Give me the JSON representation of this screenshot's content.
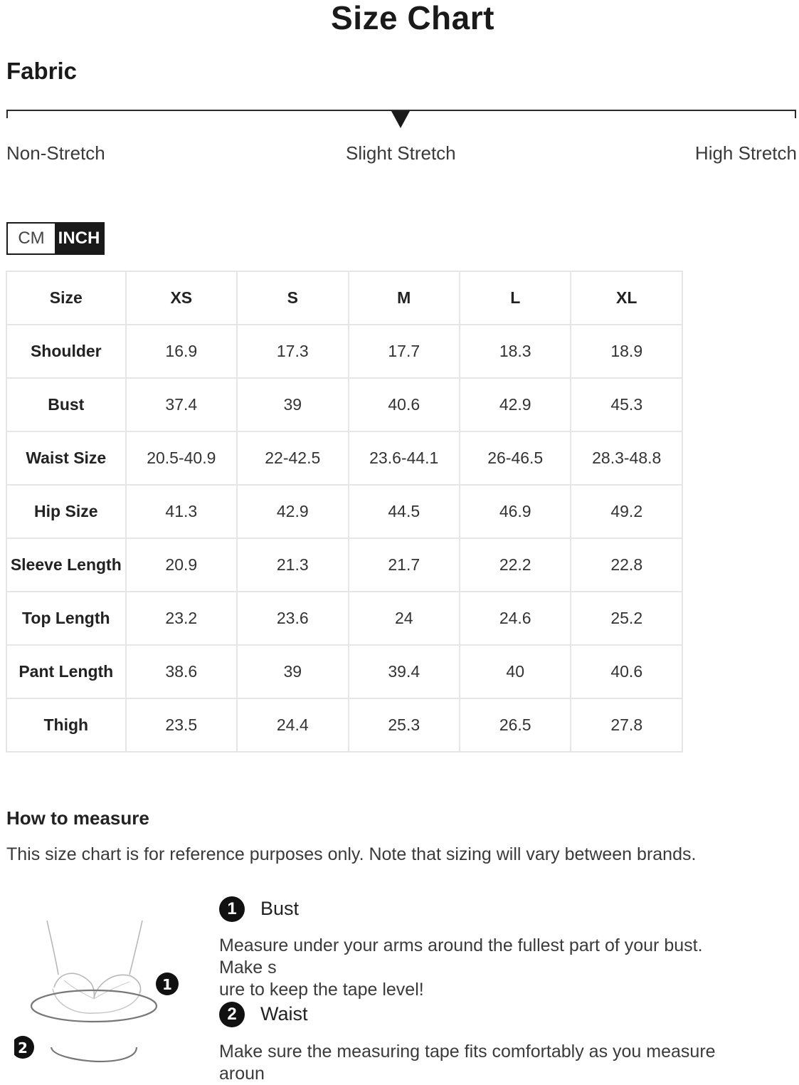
{
  "title": "Size Chart",
  "fabric": {
    "title": "Fabric",
    "scale_labels": [
      "Non-Stretch",
      "Slight Stretch",
      "High Stretch"
    ],
    "selected": "Slight Stretch"
  },
  "units": {
    "options": [
      "CM",
      "INCH"
    ],
    "selected": "INCH"
  },
  "table": {
    "header": [
      "Size",
      "XS",
      "S",
      "M",
      "L",
      "XL"
    ],
    "rows": [
      {
        "label": "Shoulder",
        "values": [
          "16.9",
          "17.3",
          "17.7",
          "18.3",
          "18.9"
        ]
      },
      {
        "label": "Bust",
        "values": [
          "37.4",
          "39",
          "40.6",
          "42.9",
          "45.3"
        ]
      },
      {
        "label": "Waist Size",
        "values": [
          "20.5-40.9",
          "22-42.5",
          "23.6-44.1",
          "26-46.5",
          "28.3-48.8"
        ]
      },
      {
        "label": "Hip Size",
        "values": [
          "41.3",
          "42.9",
          "44.5",
          "46.9",
          "49.2"
        ]
      },
      {
        "label": "Sleeve Length",
        "values": [
          "20.9",
          "21.3",
          "21.7",
          "22.2",
          "22.8"
        ]
      },
      {
        "label": "Top Length",
        "values": [
          "23.2",
          "23.6",
          "24",
          "24.6",
          "25.2"
        ]
      },
      {
        "label": "Pant Length",
        "values": [
          "38.6",
          "39",
          "39.4",
          "40",
          "40.6"
        ]
      },
      {
        "label": "Thigh",
        "values": [
          "23.5",
          "24.4",
          "25.3",
          "26.5",
          "27.8"
        ]
      }
    ]
  },
  "measure": {
    "title": "How to measure",
    "note": "This size chart is for reference purposes only. Note that sizing will vary between brands.",
    "steps": [
      {
        "number": "1",
        "title": "Bust",
        "desc_line1": "Measure under your arms around the fullest part of your bust. Make s",
        "desc_line2": "ure to keep the tape level!"
      },
      {
        "number": "2",
        "title": "Waist",
        "desc_line1": "Make sure the measuring tape fits comfortably as you measure aroun"
      }
    ]
  }
}
